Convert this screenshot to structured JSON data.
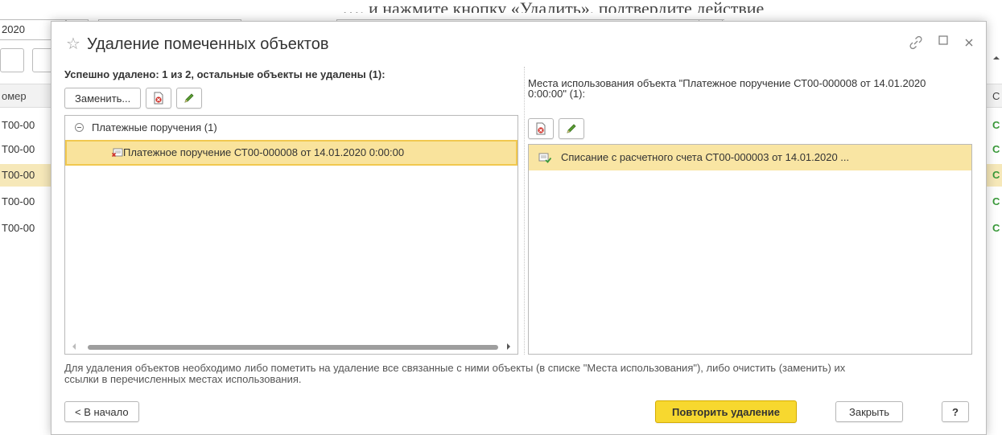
{
  "background": {
    "field_value": "2020",
    "column_header": "омер",
    "row_prefix": "Т00-00",
    "row_status": "С",
    "rows": [
      "Т00-00",
      "Т00-00",
      "Т00-00",
      "Т00-00",
      "Т00-00"
    ],
    "partial_text_above": "…, и нажмите кнопку «Удалить», подтвердите действие"
  },
  "dialog": {
    "title": "Удаление помеченных объектов",
    "status_line": "Успешно удалено: 1 из 2, остальные объекты не удалены (1):",
    "left_toolbar": {
      "replace_label": "Заменить..."
    },
    "tree": {
      "group_label": "Платежные поручения (1)",
      "item_label": "Платежное поручение СТ00-000008 от 14.01.2020 0:00:00"
    },
    "usage_title": "Места использования объекта \"Платежное поручение СТ00-000008 от 14.01.2020 0:00:00\" (1):",
    "usage_item": "Списание с расчетного счета СТ00-000003 от 14.01.2020 ...",
    "footer_note": "Для удаления объектов необходимо либо пометить на удаление все связанные с ними объекты (в списке \"Места использования\"), либо очистить (заменить) их ссылки в перечисленных местах использования.",
    "buttons": {
      "back": "< В начало",
      "repeat": "Повторить удаление",
      "close": "Закрыть",
      "help": "?"
    }
  },
  "colors": {
    "selected_row": "#f9e39c",
    "primary_button": "#f7d82f",
    "status_green": "#3a9a3a"
  }
}
